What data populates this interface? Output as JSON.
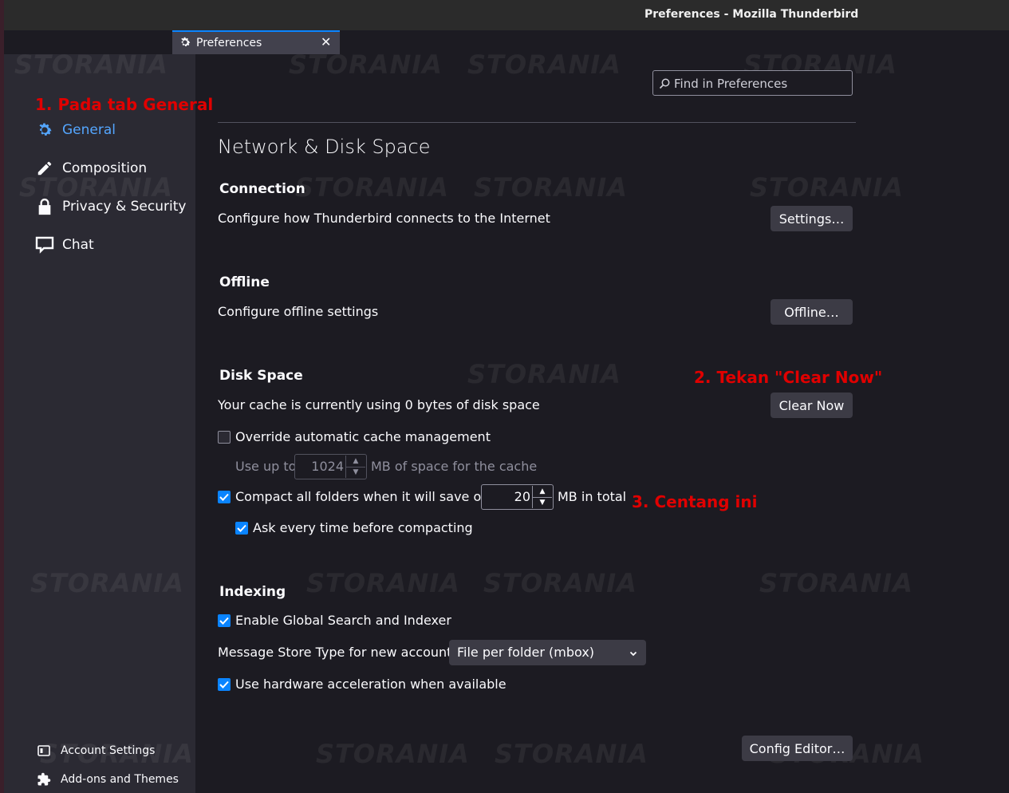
{
  "window": {
    "title": "Preferences - Mozilla Thunderbird"
  },
  "tab": {
    "label": "Preferences",
    "close": "✕"
  },
  "search": {
    "placeholder": "Find in Preferences"
  },
  "sidebar": {
    "items": [
      {
        "label": "General",
        "icon": "gear-icon"
      },
      {
        "label": "Composition",
        "icon": "pencil-icon"
      },
      {
        "label": "Privacy & Security",
        "icon": "lock-icon"
      },
      {
        "label": "Chat",
        "icon": "chat-icon"
      }
    ],
    "footer": [
      {
        "label": "Account Settings",
        "icon": "account-icon"
      },
      {
        "label": "Add-ons and Themes",
        "icon": "puzzle-icon"
      }
    ]
  },
  "annotations": {
    "step1": "1. Pada tab General",
    "step2": "2. Tekan \"Clear Now\"",
    "step3": "3. Centang ini"
  },
  "page": {
    "title": "Network & Disk Space"
  },
  "connection": {
    "heading": "Connection",
    "desc": "Configure how Thunderbird connects to the Internet",
    "button": "Settings…"
  },
  "offline": {
    "heading": "Offline",
    "desc": "Configure offline settings",
    "button": "Offline…"
  },
  "disk": {
    "heading": "Disk Space",
    "desc": "Your cache is currently using 0 bytes of disk space",
    "button": "Clear Now",
    "override_label": "Override automatic cache management",
    "override_checked": false,
    "useup_label": "Use up to",
    "useup_value": "1024",
    "useup_suffix": "MB of space for the cache",
    "compact_label": "Compact all folders when it will save over",
    "compact_checked": true,
    "compact_value": "20",
    "compact_suffix": "MB in total",
    "ask_label": "Ask every time before compacting",
    "ask_checked": true
  },
  "indexing": {
    "heading": "Indexing",
    "global_label": "Enable Global Search and Indexer",
    "global_checked": true,
    "store_label": "Message Store Type for new accounts:",
    "store_value": "File per folder (mbox)",
    "hw_label": "Use hardware acceleration when available",
    "hw_checked": true
  },
  "config_button": "Config Editor…",
  "watermark": "STORANIA",
  "colors": {
    "accent": "#0a84ff",
    "active_nav": "#54a6ff",
    "annotation": "#e00000"
  }
}
